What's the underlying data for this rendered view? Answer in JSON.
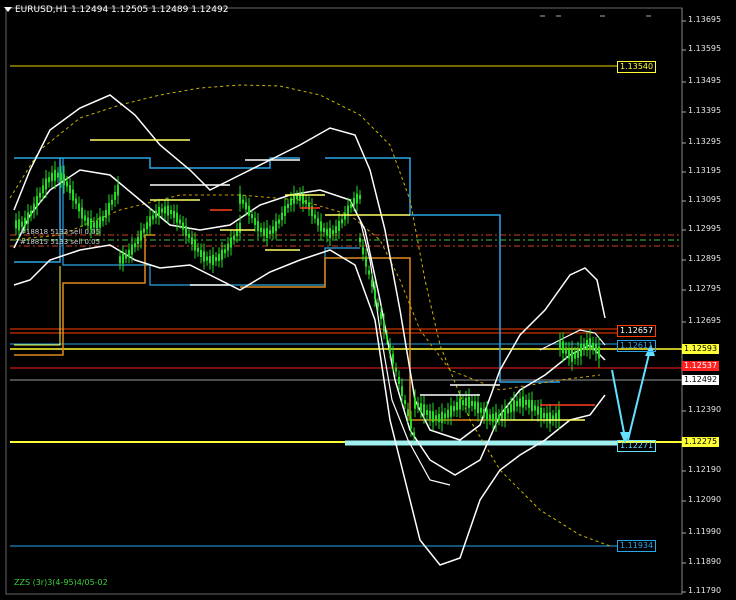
{
  "window": {
    "title": "EURUSD,H1  1.12494 1.12505 1.12489 1.12492",
    "footer": "ZZS (3r)3(4-95)4/05-02"
  },
  "axis": {
    "ticks": [
      "1.13695",
      "1.13595",
      "1.13495",
      "1.13395",
      "1.13295",
      "1.13195",
      "1.13095",
      "1.12995",
      "1.12895",
      "1.12795",
      "1.12695",
      "1.12390",
      "1.12190",
      "1.12090",
      "1.11990",
      "1.11890",
      "1.11790"
    ]
  },
  "levels": {
    "l1": "1.13540",
    "l2": "1.12657",
    "l3": "1.12611",
    "l4": "1.12593",
    "l5": "1.12537",
    "l6": "1.12492",
    "l7": "1.12275",
    "l8": "1.12271",
    "l9": "1.11934"
  },
  "orders": {
    "o1": "#18818 5133 sell 0.05",
    "o2": "#18815 5133 sell 0.05"
  },
  "colors": {
    "background": "#000000",
    "candles": "#22dd22",
    "bands": "#ffffff",
    "channel_blue": "#2aa5e6",
    "channel_orange": "#e08a1e",
    "level_yellow": "#ffff33",
    "level_red": "#ff2020",
    "arrow": "#66e0ff"
  }
}
